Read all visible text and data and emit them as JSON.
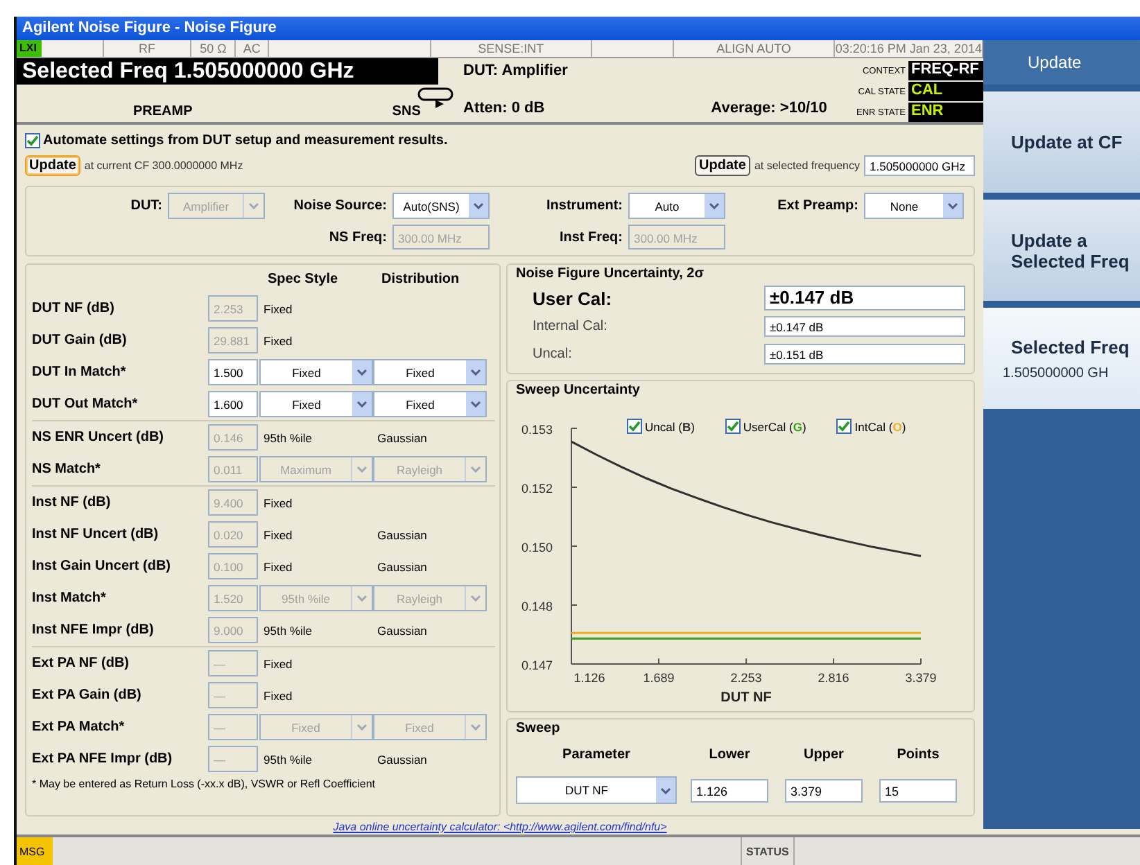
{
  "window": {
    "title": "Agilent Noise Figure - Noise Figure"
  },
  "status_strip": {
    "badge": "LXI",
    "cells": [
      "RF",
      "50 Ω",
      "AC",
      "SENSE:INT",
      "ALIGN AUTO",
      "03:20:16 PM Jan 23, 2014"
    ]
  },
  "header": {
    "selected_freq": "Selected Freq 1.505000000 GHz",
    "left_labels": [
      "PREAMP",
      "SNS"
    ],
    "dut": "DUT: Amplifier",
    "atten": "Atten: 0 dB",
    "average": "Average: >10/10",
    "states": [
      {
        "label": "CONTEXT",
        "value": "FREQ-RF",
        "color": "#ffffff"
      },
      {
        "label": "CAL STATE",
        "value": "CAL",
        "color": "#c8f000"
      },
      {
        "label": "ENR STATE",
        "value": "ENR",
        "color": "#c8f000"
      }
    ]
  },
  "automate": {
    "label": "Automate settings from DUT setup and measurement results.",
    "checked": true
  },
  "update_cf": {
    "button": "Update",
    "text": "at current CF 300.0000000 MHz"
  },
  "update_selected": {
    "button": "Update",
    "text": "at selected frequency",
    "value": "1.505000000 GHz"
  },
  "dut_setup": {
    "row1": [
      {
        "label": "DUT:",
        "kind": "select",
        "value": "Amplifier",
        "disabled": true
      },
      {
        "label": "Noise Source:",
        "kind": "select",
        "value": "Auto(SNS)",
        "disabled": false
      },
      {
        "label": "Instrument:",
        "kind": "select",
        "value": "Auto",
        "disabled": false
      },
      {
        "label": "Ext Preamp:",
        "kind": "select",
        "value": "None",
        "disabled": false
      }
    ],
    "row2": [
      {
        "label": "NS Freq:",
        "kind": "input",
        "value": "300.00 MHz",
        "disabled": true
      },
      {
        "label": "Inst Freq:",
        "kind": "input",
        "value": "300.00 MHz",
        "disabled": true
      }
    ]
  },
  "uncertainty_table": {
    "headers": [
      "Spec Style",
      "Distribution"
    ],
    "groups": [
      {
        "rows": [
          {
            "label": "DUT NF (dB)",
            "value": "2.253",
            "disabled": true,
            "spec": {
              "kind": "text",
              "text": "Fixed"
            }
          },
          {
            "label": "DUT Gain (dB)",
            "value": "29.881",
            "disabled": true,
            "spec": {
              "kind": "text",
              "text": "Fixed"
            }
          },
          {
            "label": "DUT In Match*",
            "value": "1.500",
            "disabled": false,
            "spec": {
              "kind": "select",
              "text": "Fixed",
              "disabled": false
            },
            "dist": {
              "kind": "select",
              "text": "Fixed",
              "disabled": false
            }
          },
          {
            "label": "DUT Out Match*",
            "value": "1.600",
            "disabled": false,
            "spec": {
              "kind": "select",
              "text": "Fixed",
              "disabled": false
            },
            "dist": {
              "kind": "select",
              "text": "Fixed",
              "disabled": false
            }
          }
        ]
      },
      {
        "rows": [
          {
            "label": "NS ENR Uncert (dB)",
            "value": "0.146",
            "disabled": true,
            "spec": {
              "kind": "text",
              "text": "95th %ile"
            },
            "dist": {
              "kind": "text",
              "text": "Gaussian"
            }
          },
          {
            "label": "NS Match*",
            "value": "0.011",
            "disabled": true,
            "spec": {
              "kind": "select",
              "text": "Maximum",
              "disabled": true
            },
            "dist": {
              "kind": "select",
              "text": "Rayleigh",
              "disabled": true
            }
          }
        ]
      },
      {
        "rows": [
          {
            "label": "Inst NF (dB)",
            "value": "9.400",
            "disabled": true,
            "spec": {
              "kind": "text",
              "text": "Fixed"
            }
          },
          {
            "label": "Inst NF Uncert (dB)",
            "value": "0.020",
            "disabled": true,
            "spec": {
              "kind": "text",
              "text": "Fixed"
            },
            "dist": {
              "kind": "text",
              "text": "Gaussian"
            }
          },
          {
            "label": "Inst Gain Uncert (dB)",
            "value": "0.100",
            "disabled": true,
            "spec": {
              "kind": "text",
              "text": "Fixed"
            },
            "dist": {
              "kind": "text",
              "text": "Gaussian"
            }
          },
          {
            "label": "Inst Match*",
            "value": "1.520",
            "disabled": true,
            "spec": {
              "kind": "select",
              "text": "95th %ile",
              "disabled": true
            },
            "dist": {
              "kind": "select",
              "text": "Rayleigh",
              "disabled": true
            }
          },
          {
            "label": "Inst NFE Impr (dB)",
            "value": "9.000",
            "disabled": true,
            "spec": {
              "kind": "text",
              "text": "95th %ile"
            },
            "dist": {
              "kind": "text",
              "text": "Gaussian"
            }
          }
        ]
      },
      {
        "rows": [
          {
            "label": "Ext PA NF (dB)",
            "value": "—",
            "disabled": true,
            "spec": {
              "kind": "text",
              "text": "Fixed"
            }
          },
          {
            "label": "Ext PA Gain (dB)",
            "value": "—",
            "disabled": true,
            "spec": {
              "kind": "text",
              "text": "Fixed"
            }
          },
          {
            "label": "Ext PA Match*",
            "value": "—",
            "disabled": true,
            "spec": {
              "kind": "select",
              "text": "Fixed",
              "disabled": true
            },
            "dist": {
              "kind": "select",
              "text": "Fixed",
              "disabled": true
            }
          },
          {
            "label": "Ext PA NFE Impr (dB)",
            "value": "—",
            "disabled": true,
            "spec": {
              "kind": "text",
              "text": "95th %ile"
            },
            "dist": {
              "kind": "text",
              "text": "Gaussian"
            }
          }
        ]
      }
    ],
    "note": "* May be entered as Return Loss (-xx.x dB), VSWR or Refl Coefficient"
  },
  "nf_uncertainty": {
    "title": "Noise Figure Uncertainty, 2σ",
    "rows": [
      {
        "label": "User Cal:",
        "value": "±0.147 dB",
        "kind": "main"
      },
      {
        "label": "Internal Cal:",
        "value": "±0.147 dB",
        "kind": "sub"
      },
      {
        "label": "Uncal:",
        "value": "±0.151 dB",
        "kind": "sub"
      }
    ]
  },
  "sweep_uncertainty": {
    "title": "Sweep Uncertainty",
    "legend": [
      {
        "open": "(",
        "key": "B",
        "close": ")",
        "checked": true
      },
      {
        "open": "(",
        "key": "G",
        "close": ")",
        "checked": true
      },
      {
        "open": "(",
        "key": "O",
        "close": ")",
        "checked": true
      }
    ],
    "chart_data": {
      "type": "line",
      "xlabel": "DUT NF",
      "x": [
        1.126,
        1.287,
        1.448,
        1.609,
        1.77,
        1.931,
        2.092,
        2.253,
        2.413,
        2.574,
        2.735,
        2.896,
        3.057,
        3.218,
        3.379
      ],
      "series": [
        {
          "name": "Uncal",
          "color": "#303030",
          "values": [
            0.15266,
            0.15233,
            0.15202,
            0.15173,
            0.15147,
            0.15123,
            0.15101,
            0.1508,
            0.15061,
            0.15044,
            0.15028,
            0.15013,
            0.14999,
            0.14987,
            0.14975
          ]
        },
        {
          "name": "UserCal",
          "color": "#3aa020",
          "values": [
            0.14765,
            0.14765,
            0.14765,
            0.14765,
            0.14765,
            0.14765,
            0.14765,
            0.14765,
            0.14765,
            0.14765,
            0.14765,
            0.14765,
            0.14765,
            0.14765,
            0.14765
          ]
        },
        {
          "name": "IntCal",
          "color": "#f0b020",
          "values": [
            0.14779,
            0.14779,
            0.14779,
            0.14779,
            0.14779,
            0.14779,
            0.14779,
            0.14779,
            0.14779,
            0.14779,
            0.14779,
            0.14779,
            0.14779,
            0.14779,
            0.14779
          ]
        }
      ],
      "xlim": [
        1.126,
        3.379
      ],
      "ylim": [
        0.147,
        0.153
      ],
      "xticks": [
        1.126,
        1.689,
        2.253,
        2.816,
        3.379
      ],
      "yticks": [
        {
          "value": 0.147,
          "label": "0.147"
        },
        {
          "value": 0.1485,
          "label": "0.148"
        },
        {
          "value": 0.15,
          "label": "0.150"
        },
        {
          "value": 0.1515,
          "label": "0.152"
        },
        {
          "value": 0.153,
          "label": "0.153"
        }
      ]
    }
  },
  "sweep": {
    "title": "Sweep",
    "headers": [
      "Parameter",
      "Lower",
      "Upper",
      "Points"
    ],
    "parameter": "DUT NF",
    "lower": "1.126",
    "upper": "3.379",
    "points": "15"
  },
  "link": "Java online uncertainty calculator: <http://www.agilent.com/find/nfu>",
  "softkeys": {
    "title": "Update",
    "keys": [
      {
        "lines": [
          "Update at CF"
        ],
        "selected": false
      },
      {
        "lines": [
          "Update a",
          "Selected Freq"
        ],
        "selected": false
      },
      {
        "lines": [
          "Selected Freq",
          "1.505000000 GH"
        ],
        "selected": true
      }
    ]
  },
  "status_bar": {
    "msg": "MSG",
    "status": "STATUS"
  }
}
